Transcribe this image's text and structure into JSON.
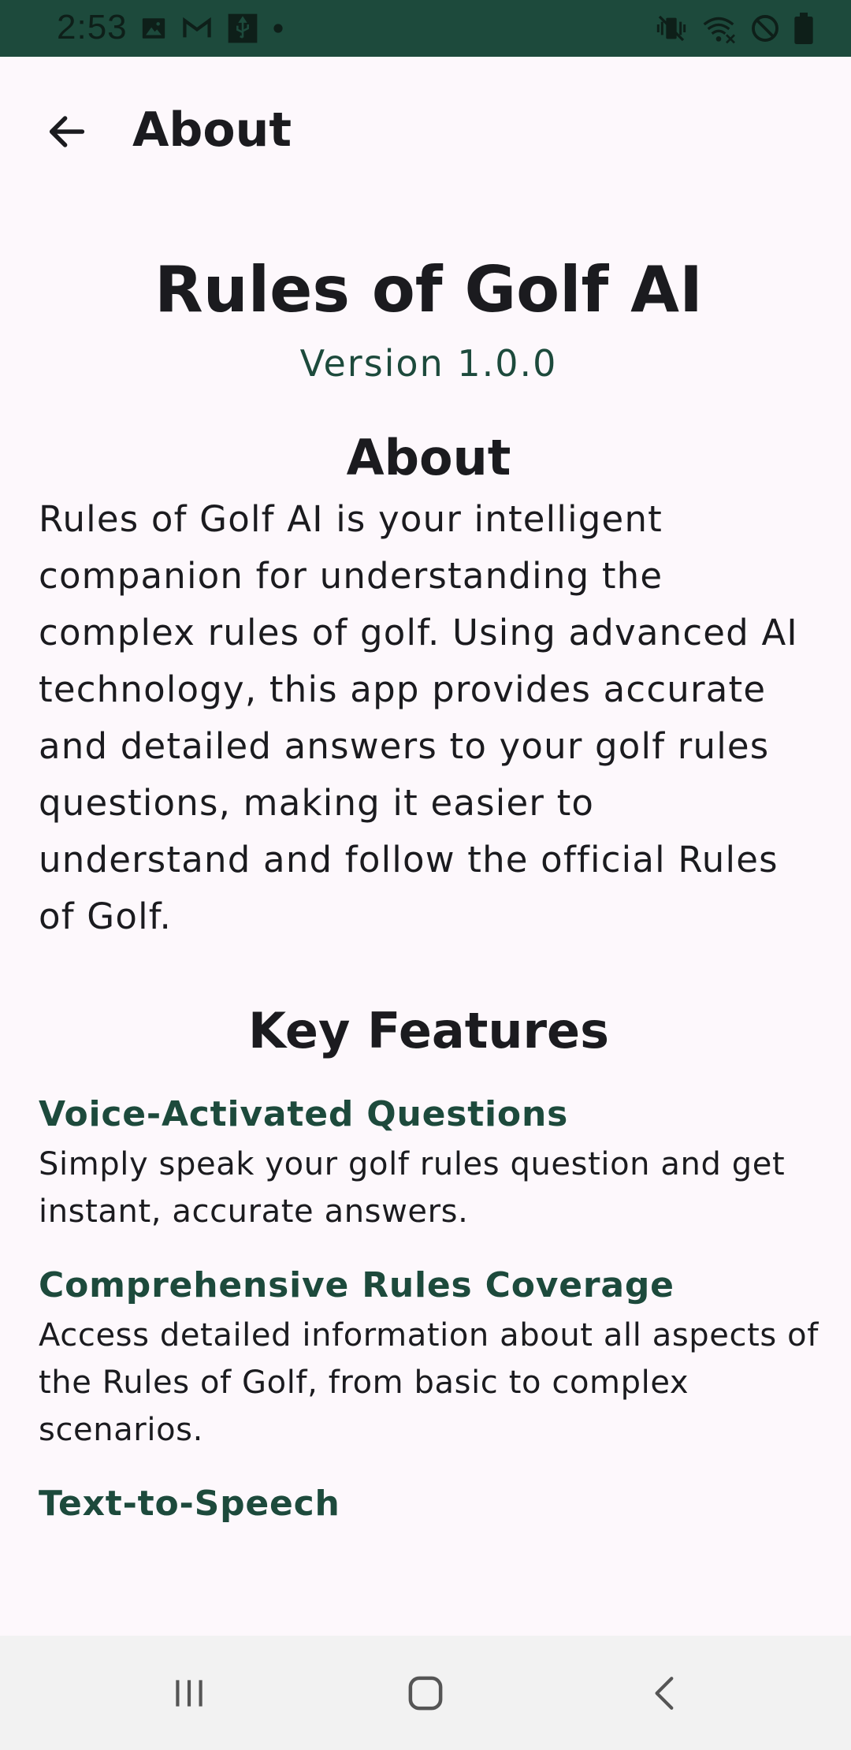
{
  "status_bar": {
    "time": "2:53",
    "left_icons": [
      "image-icon",
      "gmail-icon",
      "usb-icon",
      "dot-icon"
    ],
    "right_icons": [
      "vibrate-off-icon",
      "wifi-icon",
      "do-not-disturb-icon",
      "battery-icon"
    ]
  },
  "app_bar": {
    "title": "About",
    "back_icon": "arrow-back-icon"
  },
  "content": {
    "app_name": "Rules of Golf AI",
    "version": "Version 1.0.0",
    "about_heading": "About",
    "about_text": "Rules of Golf AI is your intelligent companion for understanding the complex rules of golf. Using advanced AI technology, this app provides accurate and detailed answers to your golf rules questions, making it easier to understand and follow the official Rules of Golf.",
    "features_heading": "Key Features",
    "features": [
      {
        "title": "Voice-Activated Questions",
        "description": "Simply speak your golf rules question and get instant, accurate answers."
      },
      {
        "title": "Comprehensive Rules Coverage",
        "description": "Access detailed information about all aspects of the Rules of Golf, from basic to complex scenarios."
      },
      {
        "title": "Text-to-Speech",
        "description": ""
      }
    ]
  },
  "nav_bar": {
    "icons": [
      "recent-apps-icon",
      "home-icon",
      "back-icon"
    ]
  },
  "colors": {
    "status_bar": "#1d4a3c",
    "accent": "#1d4a3c",
    "background": "#fdf8fc",
    "text": "#1b1b1f",
    "nav_bar": "#f2f2f2"
  }
}
